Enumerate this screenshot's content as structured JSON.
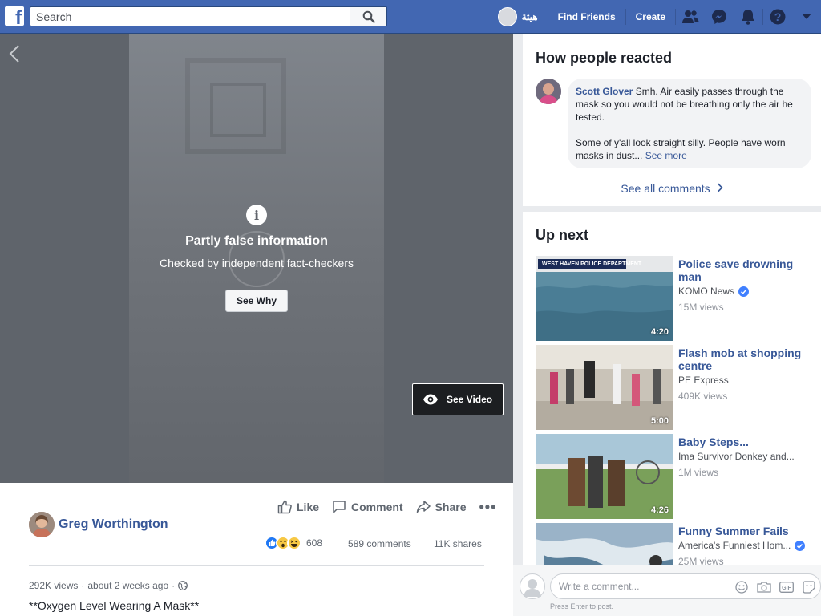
{
  "header": {
    "logo_letter": "f",
    "search_placeholder": "Search",
    "profile_name": "هيثة",
    "find_friends": "Find Friends",
    "create": "Create",
    "icons": [
      "friends-icon",
      "messenger-icon",
      "notifications-icon",
      "help-icon",
      "account-menu-icon"
    ]
  },
  "video": {
    "warning_title": "Partly false information",
    "warning_subtitle": "Checked by independent fact-checkers",
    "see_why": "See Why",
    "see_video": "See Video"
  },
  "post": {
    "actions": {
      "like": "Like",
      "comment": "Comment",
      "share": "Share",
      "more": "•••"
    },
    "author": "Greg Worthington",
    "reaction_count": "608",
    "comments_count": "589 comments",
    "shares_count": "11K shares",
    "views": "292K views",
    "time": "about 2 weeks ago",
    "text": "**Oxygen Level Wearing A Mask**"
  },
  "reactions_section": {
    "title": "How people reacted",
    "comment": {
      "author": "Scott Glover",
      "text1": "Smh. Air easily passes through the mask so you would not be breathing only the air he tested.",
      "text2": "Some of y'all look straight silly. People have worn masks in dust...",
      "see_more": "See more"
    },
    "see_all": "See all comments"
  },
  "up_next": {
    "title": "Up next",
    "videos": [
      {
        "title": "Police save drowning man",
        "source": "KOMO News",
        "verified": true,
        "views": "15M views",
        "duration": "4:20",
        "thumb_caption": "WEST HAVEN POLICE DEPARTMENT"
      },
      {
        "title": "Flash mob at shopping centre",
        "source": "PE Express",
        "verified": false,
        "views": "409K views",
        "duration": "5:00"
      },
      {
        "title": "Baby Steps...",
        "source": "Ima Survivor Donkey and...",
        "verified": false,
        "views": "1M views",
        "duration": "4:26"
      },
      {
        "title": "Funny Summer Fails",
        "source": "America's Funniest Hom...",
        "verified": true,
        "views": "25M views",
        "duration": ""
      }
    ]
  },
  "composer": {
    "placeholder": "Write a comment...",
    "hint": "Press Enter to post."
  },
  "colors": {
    "brand": "#4267b2",
    "link": "#385898",
    "verified": "#4080ff"
  }
}
